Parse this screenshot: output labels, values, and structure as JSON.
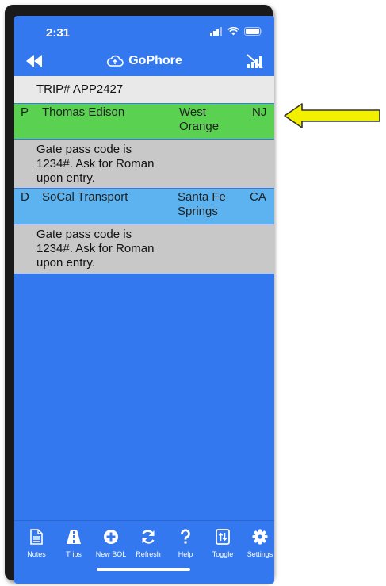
{
  "status": {
    "time": "2:31"
  },
  "nav": {
    "title": "GoPhore"
  },
  "trip": {
    "label": "TRIP# APP2427"
  },
  "stops": [
    {
      "type": "P",
      "name": "Thomas Edison",
      "city": "West Orange",
      "state": "NJ",
      "note": "Gate pass code is 1234#. Ask for Roman upon entry.",
      "color": "#5bd152"
    },
    {
      "type": "D",
      "name": "SoCal Transport",
      "city": "Santa Fe Springs",
      "state": "CA",
      "note": "Gate pass code is 1234#. Ask for Roman upon entry.",
      "color": "#5cb3ef"
    }
  ],
  "tabs": [
    {
      "label": "Notes",
      "icon": "notes-icon"
    },
    {
      "label": "Trips",
      "icon": "road-icon"
    },
    {
      "label": "New BOL",
      "icon": "plus-circle-icon"
    },
    {
      "label": "Refresh",
      "icon": "refresh-icon"
    },
    {
      "label": "Help",
      "icon": "question-icon"
    },
    {
      "label": "Toggle",
      "icon": "toggle-icon"
    },
    {
      "label": "Settings",
      "icon": "gear-icon"
    }
  ],
  "colors": {
    "primary": "#3478f0",
    "pickup": "#5bd152",
    "delivery": "#5cb3ef",
    "note": "#c8c8c8",
    "arrow": "#f2f000"
  }
}
